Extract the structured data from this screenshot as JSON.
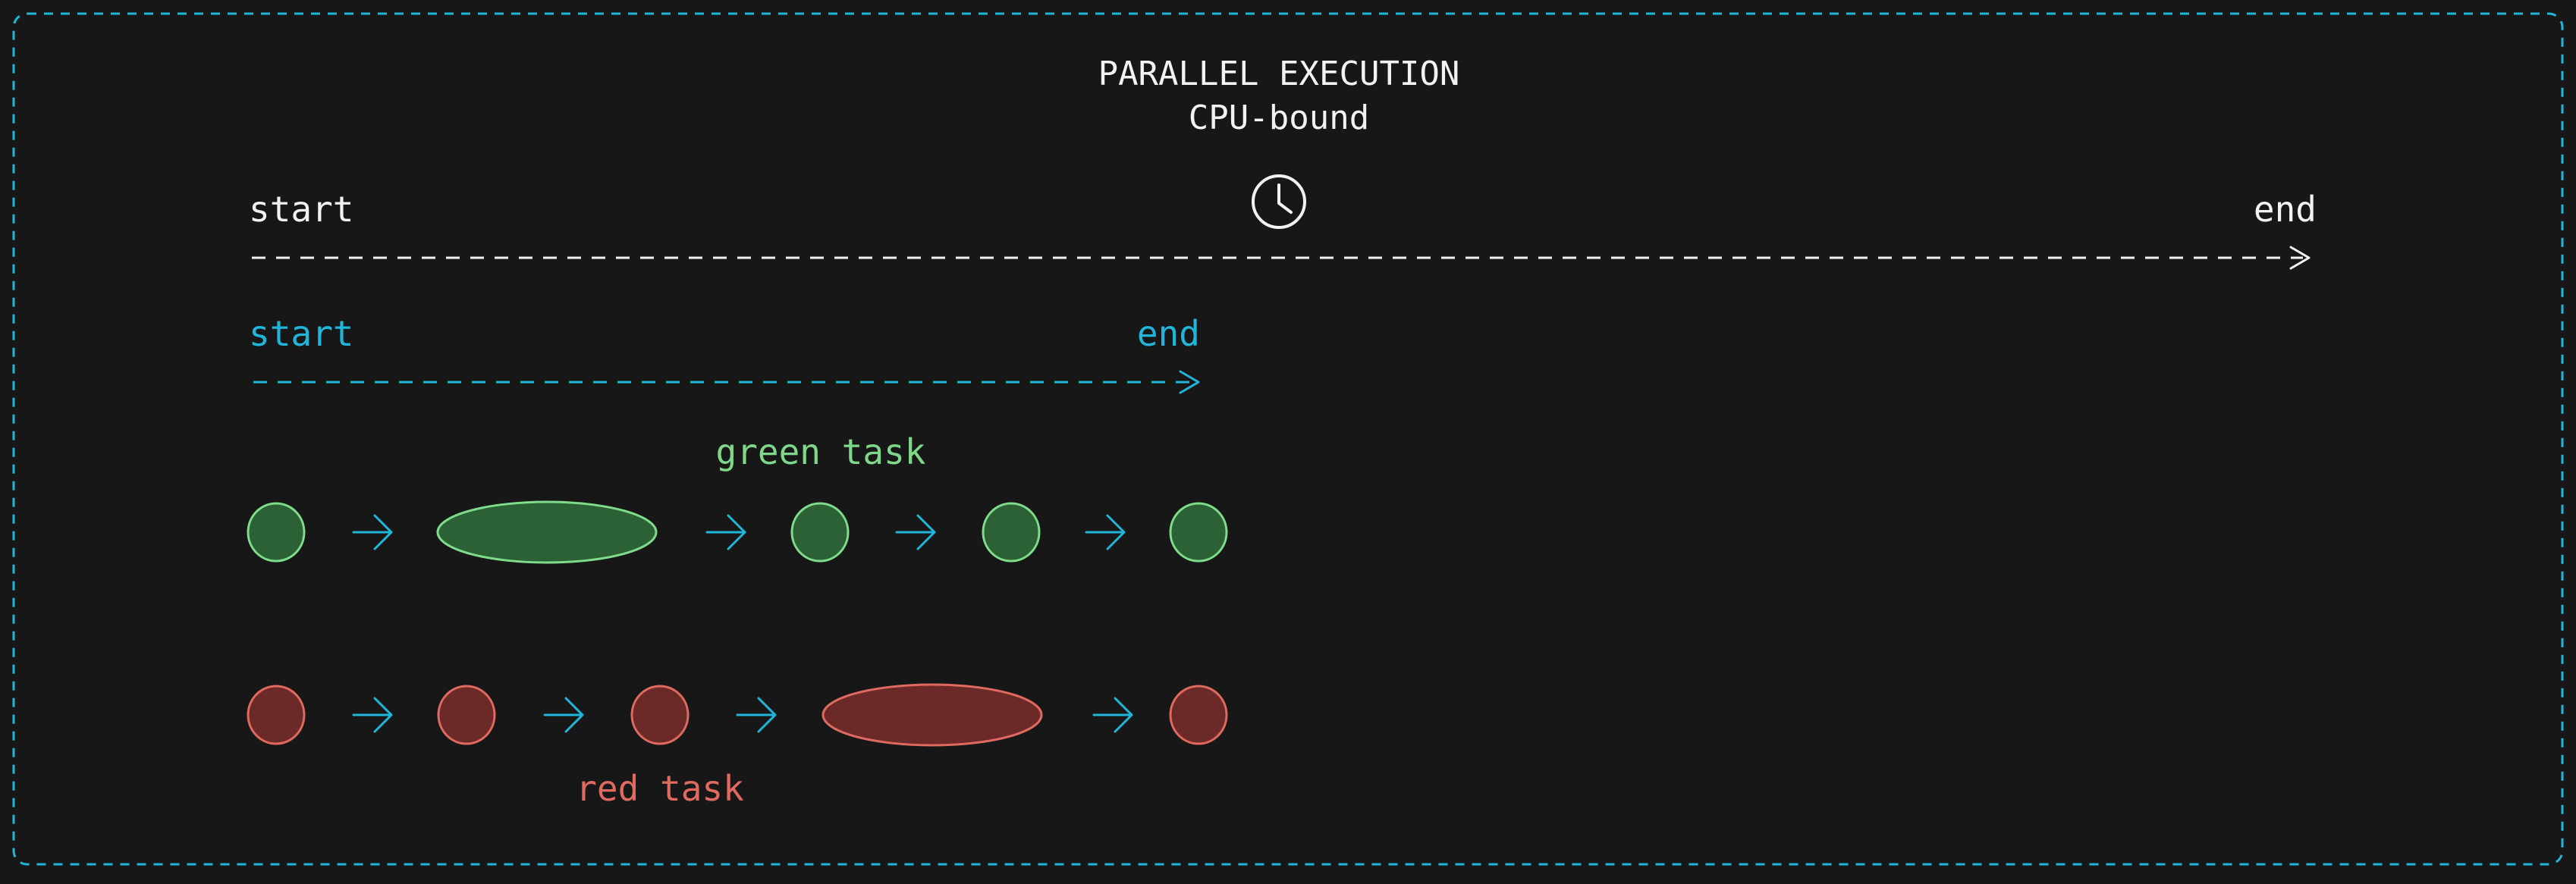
{
  "title": {
    "line1": "PARALLEL EXECUTION",
    "line2": "CPU-bound"
  },
  "overall_timeline": {
    "start_label": "start",
    "end_label": "end",
    "icon": "clock-icon"
  },
  "parallel_timeline": {
    "start_label": "start",
    "end_label": "end"
  },
  "tasks": {
    "green": {
      "label": "green task",
      "sequence": [
        "circle",
        "ellipse",
        "circle",
        "circle",
        "circle"
      ]
    },
    "red": {
      "label": "red task",
      "sequence": [
        "circle",
        "circle",
        "circle",
        "ellipse",
        "circle"
      ]
    }
  },
  "colors": {
    "background": "#171717",
    "frame": "#1fb6d9",
    "white": "#f2f2f2",
    "cyan": "#1fb6d9",
    "green_fill": "#2c6035",
    "green_stroke": "#7fdc8a",
    "green_text": "#7fd78a",
    "red_fill": "#6b2a27",
    "red_stroke": "#e06a60",
    "red_text": "#e06a60"
  }
}
